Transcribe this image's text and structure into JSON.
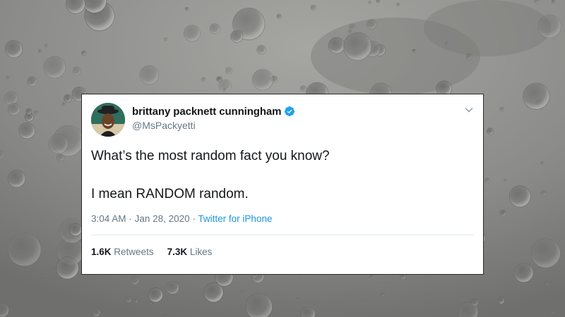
{
  "tweet": {
    "author_name": "brittany packnett cunningham",
    "handle": "@MsPackyetti",
    "text_lines": [
      "What’s the most random fact you know?",
      "I mean RANDOM random."
    ],
    "time": "3:04 AM",
    "separator": "·",
    "date": "Jan 28, 2020",
    "source": "Twitter for iPhone",
    "retweets_count": "1.6K",
    "retweets_label": "Retweets",
    "likes_count": "7.3K",
    "likes_label": "Likes"
  },
  "icons": {
    "verified": "verified-badge-icon",
    "menu": "chevron-down-icon",
    "avatar": "profile-avatar"
  },
  "colors": {
    "card_background": "#ffffff",
    "primary_text": "#14171a",
    "secondary_text": "#657786",
    "link": "#1b95e0",
    "verified": "#1da1f2",
    "divider": "#e1e8ed",
    "background": "#8e8e8c"
  }
}
